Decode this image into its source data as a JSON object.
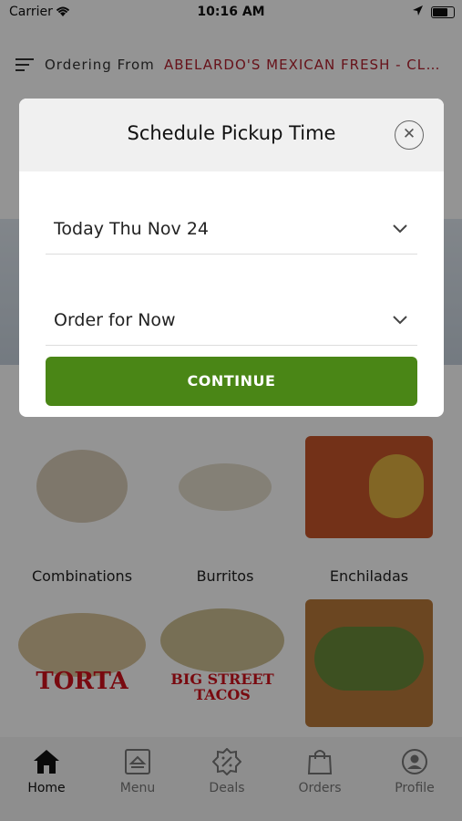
{
  "status_bar": {
    "carrier": "Carrier",
    "time": "10:16 AM"
  },
  "header": {
    "ordering_label": "Ordering From",
    "store_name": "ABELARDO'S MEXICAN FRESH - CLAYTON"
  },
  "categories": [
    {
      "label": "Combinations"
    },
    {
      "label": "Burritos"
    },
    {
      "label": "Enchiladas"
    },
    {
      "label": "TORTA"
    },
    {
      "label": "BIG STREET TACOS"
    },
    {
      "label": ""
    }
  ],
  "tabs": [
    {
      "label": "Home",
      "icon": "home-icon"
    },
    {
      "label": "Menu",
      "icon": "menu-book-icon"
    },
    {
      "label": "Deals",
      "icon": "deals-badge-icon"
    },
    {
      "label": "Orders",
      "icon": "shopping-bag-icon"
    },
    {
      "label": "Profile",
      "icon": "profile-icon"
    }
  ],
  "modal": {
    "title": "Schedule Pickup Time",
    "date_value": "Today Thu Nov 24",
    "time_value": "Order for Now",
    "continue_label": "CONTINUE"
  },
  "colors": {
    "brand_red": "#b21f2d",
    "continue_green": "#4a8616"
  }
}
